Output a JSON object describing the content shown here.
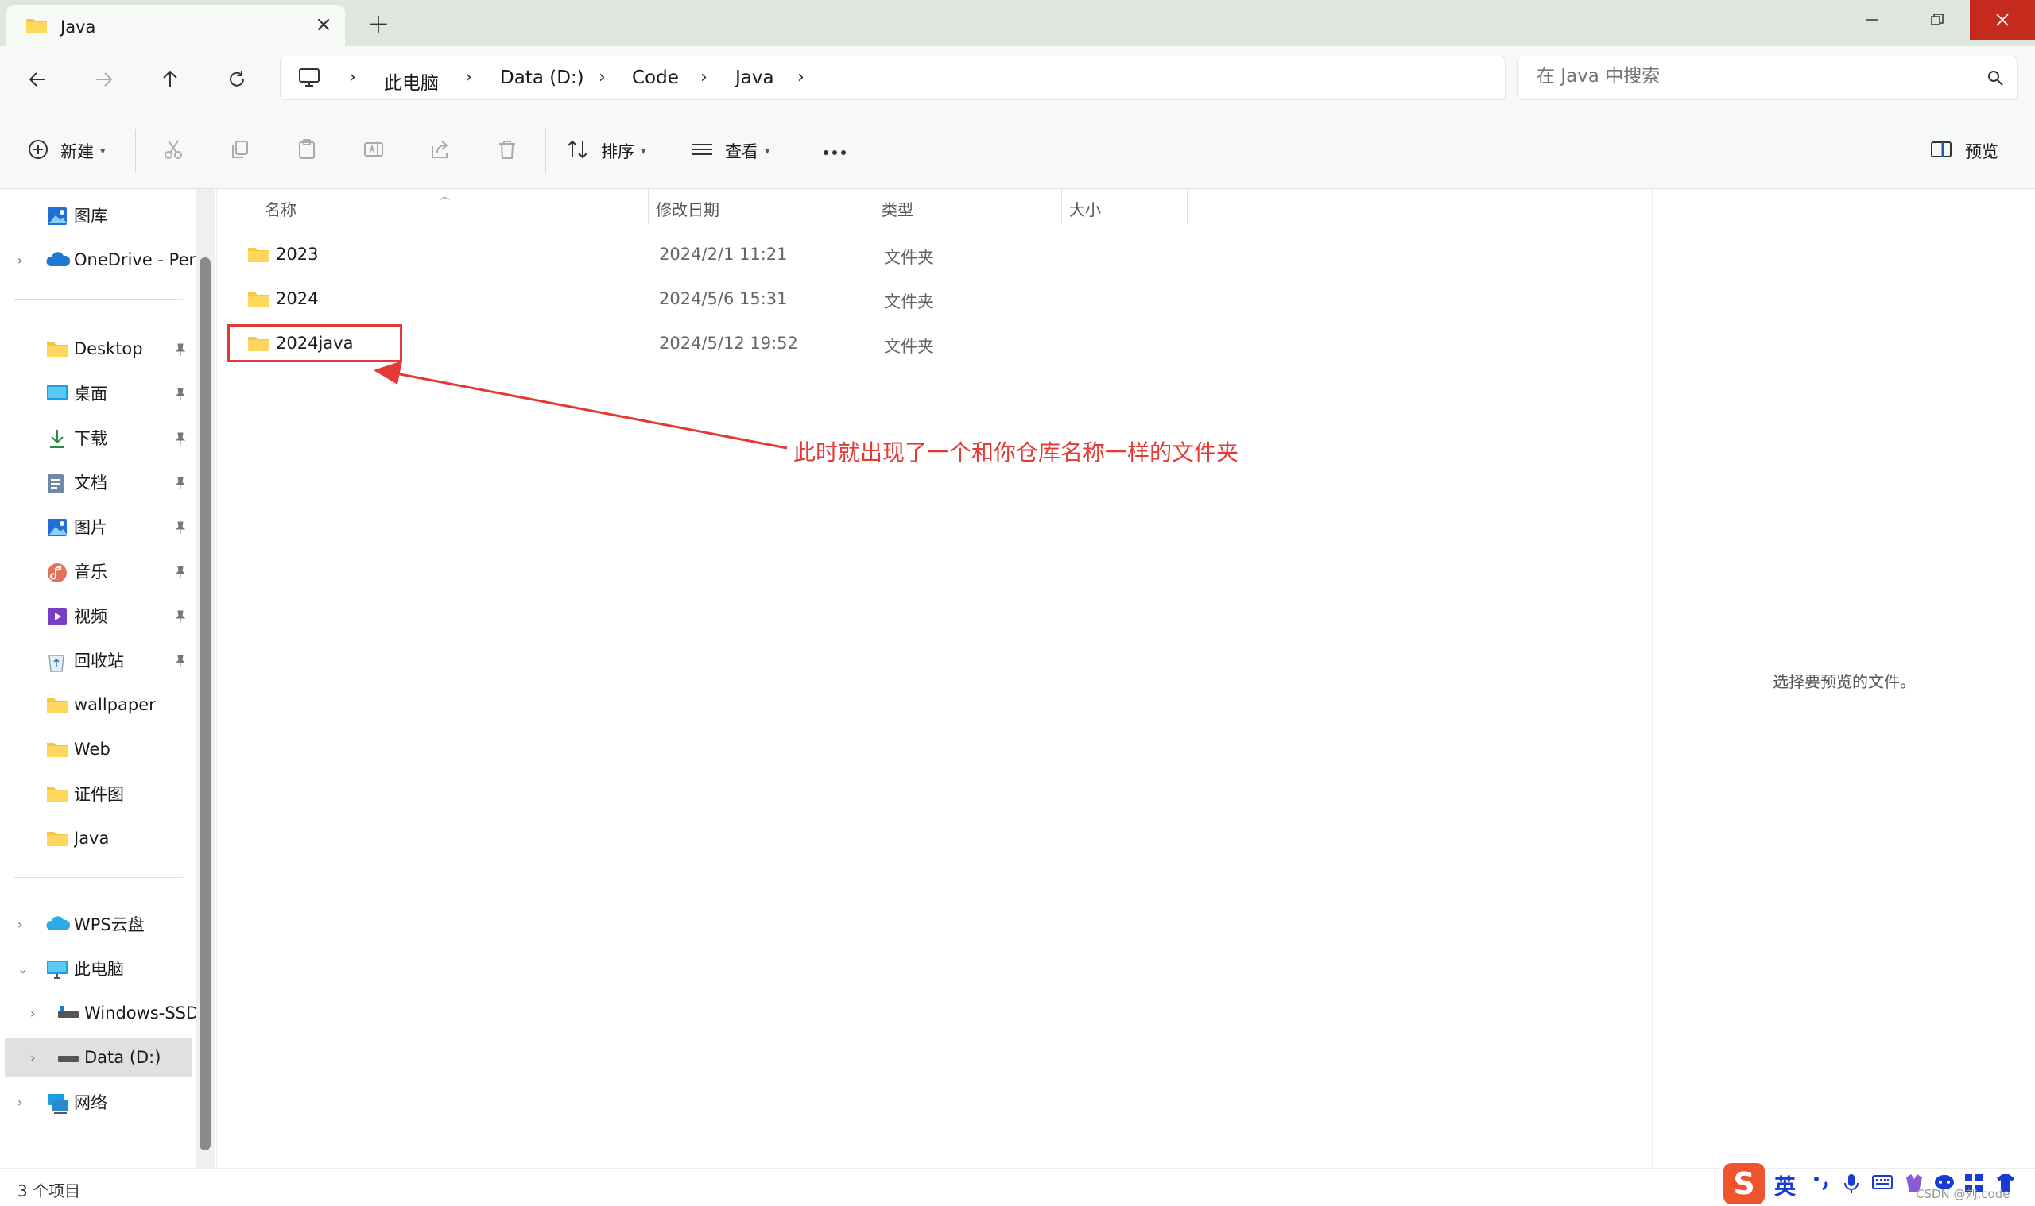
{
  "window": {
    "tab_title": "Java",
    "accent_close": "#c42b1c"
  },
  "breadcrumb": [
    "此电脑",
    "Data (D:)",
    "Code",
    "Java"
  ],
  "search": {
    "placeholder": "在 Java 中搜索"
  },
  "toolbar": {
    "new_label": "新建",
    "sort_label": "排序",
    "view_label": "查看",
    "preview_label": "预览"
  },
  "sidebar": {
    "top_items": [
      {
        "label": "图库",
        "icon": "gallery-icon"
      },
      {
        "label": "OneDrive - Per",
        "icon": "onedrive-icon"
      }
    ],
    "quick_access": [
      {
        "label": "Desktop",
        "icon": "folder-icon",
        "pinned": true
      },
      {
        "label": "桌面",
        "icon": "desktop-icon",
        "pinned": true
      },
      {
        "label": "下载",
        "icon": "download-icon",
        "pinned": true
      },
      {
        "label": "文档",
        "icon": "document-icon",
        "pinned": true
      },
      {
        "label": "图片",
        "icon": "pictures-icon",
        "pinned": true
      },
      {
        "label": "音乐",
        "icon": "music-icon",
        "pinned": true
      },
      {
        "label": "视频",
        "icon": "video-icon",
        "pinned": true
      },
      {
        "label": "回收站",
        "icon": "recycle-bin-icon",
        "pinned": true
      },
      {
        "label": "wallpaper",
        "icon": "folder-icon",
        "pinned": false
      },
      {
        "label": "Web",
        "icon": "folder-icon",
        "pinned": false
      },
      {
        "label": "证件图",
        "icon": "folder-icon",
        "pinned": false
      },
      {
        "label": "Java",
        "icon": "folder-icon",
        "pinned": false
      }
    ],
    "tree": [
      {
        "label": "WPS云盘",
        "icon": "wps-cloud-icon"
      },
      {
        "label": "此电脑",
        "icon": "this-pc-icon"
      },
      {
        "label": "Windows-SSD",
        "icon": "drive-icon"
      },
      {
        "label": "Data (D:)",
        "icon": "drive-icon"
      },
      {
        "label": "网络",
        "icon": "network-icon"
      }
    ]
  },
  "columns": [
    "名称",
    "修改日期",
    "类型",
    "大小"
  ],
  "files": [
    {
      "name": "2023",
      "date": "2024/2/1 11:21",
      "type": "文件夹"
    },
    {
      "name": "2024",
      "date": "2024/5/6 15:31",
      "type": "文件夹"
    },
    {
      "name": "2024java",
      "date": "2024/5/12 19:52",
      "type": "文件夹"
    }
  ],
  "annotation": "此时就出现了一个和你仓库名称一样的文件夹",
  "preview_message": "选择要预览的文件。",
  "status": "3 个项目",
  "ime": {
    "logo": "S",
    "lang": "英"
  },
  "watermark": "CSDN @刘.code"
}
